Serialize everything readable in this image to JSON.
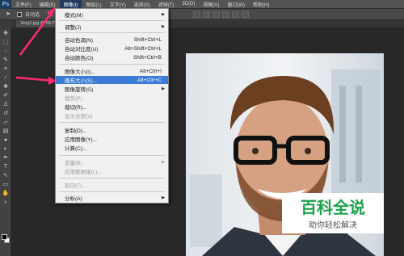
{
  "app": {
    "logo": "Ps"
  },
  "menubar": {
    "items": [
      {
        "label": "文件(F)"
      },
      {
        "label": "编辑(E)"
      },
      {
        "label": "图像(I)"
      },
      {
        "label": "图层(L)"
      },
      {
        "label": "文字(Y)"
      },
      {
        "label": "选择(S)"
      },
      {
        "label": "滤镜(T)"
      },
      {
        "label": "3D(D)"
      },
      {
        "label": "视图(V)"
      },
      {
        "label": "窗口(W)"
      },
      {
        "label": "帮助(H)"
      }
    ]
  },
  "options_bar": {
    "auto_select_label": "自动选"
  },
  "document": {
    "tab_label": "timg1.jpg @ 66.7%"
  },
  "image_menu": {
    "items": [
      {
        "label": "模式(M)",
        "shortcut": "",
        "submenu": true,
        "disabled": false
      },
      {
        "label": "调整(J)",
        "shortcut": "",
        "submenu": true,
        "disabled": false
      },
      {
        "label": "自动色调(N)",
        "shortcut": "Shift+Ctrl+L",
        "submenu": false,
        "disabled": false
      },
      {
        "label": "自动对比度(U)",
        "shortcut": "Alt+Shift+Ctrl+L",
        "submenu": false,
        "disabled": false
      },
      {
        "label": "自动颜色(O)",
        "shortcut": "Shift+Ctrl+B",
        "submenu": false,
        "disabled": false
      },
      {
        "label": "图像大小(I)...",
        "shortcut": "Alt+Ctrl+I",
        "submenu": false,
        "disabled": false
      },
      {
        "label": "画布大小(S)...",
        "shortcut": "Alt+Ctrl+C",
        "submenu": false,
        "disabled": false,
        "highlighted": true
      },
      {
        "label": "图像旋转(G)",
        "shortcut": "",
        "submenu": true,
        "disabled": false
      },
      {
        "label": "裁剪(P)",
        "shortcut": "",
        "submenu": false,
        "disabled": true
      },
      {
        "label": "裁切(R)...",
        "shortcut": "",
        "submenu": false,
        "disabled": false
      },
      {
        "label": "显示全部(V)",
        "shortcut": "",
        "submenu": false,
        "disabled": true
      },
      {
        "label": "复制(D)...",
        "shortcut": "",
        "submenu": false,
        "disabled": false
      },
      {
        "label": "应用图像(Y)...",
        "shortcut": "",
        "submenu": false,
        "disabled": false
      },
      {
        "label": "计算(C)...",
        "shortcut": "",
        "submenu": false,
        "disabled": false
      },
      {
        "label": "变量(B)",
        "shortcut": "",
        "submenu": true,
        "disabled": true
      },
      {
        "label": "应用数据组(L)...",
        "shortcut": "",
        "submenu": false,
        "disabled": true
      },
      {
        "label": "陷印(T)...",
        "shortcut": "",
        "submenu": false,
        "disabled": true
      },
      {
        "label": "分析(A)",
        "shortcut": "",
        "submenu": true,
        "disabled": false
      }
    ]
  },
  "watermark": {
    "title": "百科全说",
    "subtitle": "助你轻松解决"
  },
  "colors": {
    "highlight": "#3a7bd5",
    "arrow": "#ff2a6d",
    "watermark_green": "#1aa24a"
  }
}
